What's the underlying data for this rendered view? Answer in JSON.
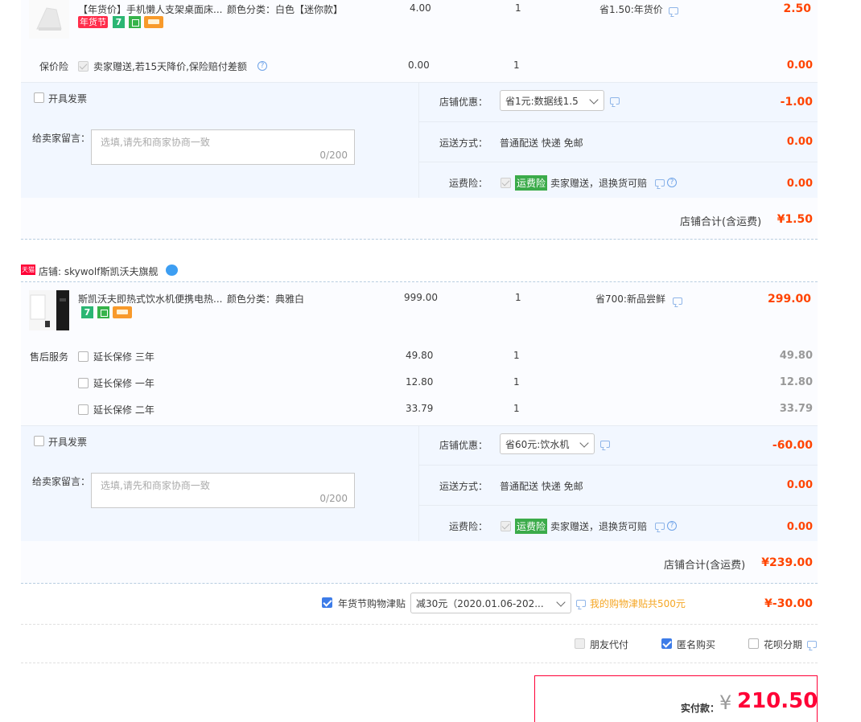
{
  "order1": {
    "product": {
      "title": "【年货价】手机懒人支架桌面床...",
      "attr": "颜色分类：白色【迷你款】",
      "price": "4.00",
      "qty": "1",
      "discount": "省1.50:年货价",
      "subtotal": "2.50",
      "badge": "年货节"
    },
    "insurance": {
      "label": "保价险",
      "text": "卖家赠送,若15天降价,保险赔付差额",
      "price": "0.00",
      "qty": "1",
      "subtotal": "0.00"
    },
    "invoice_label": "开具发票",
    "message_label": "给卖家留言：",
    "message_placeholder": "选填,请先和商家协商一致",
    "message_count": "0/200",
    "coupon_label": "店铺优惠：",
    "coupon_value": "省1元:数据线1.5",
    "coupon_amount": "-1.00",
    "shipping_label": "运送方式：",
    "shipping_value": "普通配送 快递 免邮",
    "shipping_amount": "0.00",
    "freight_label": "运费险：",
    "freight_tag": "运费险",
    "freight_text": "卖家赠送，退换货可赔",
    "freight_amount": "0.00",
    "total_label": "店铺合计(含运费)",
    "total_amount": "¥1.50"
  },
  "order2": {
    "store_badge": "天猫",
    "store_label": "店铺: skywolf斯凯沃夫旗舰",
    "product": {
      "title": "斯凯沃夫即热式饮水机便携电热...",
      "attr": "颜色分类：典雅白",
      "price": "999.00",
      "qty": "1",
      "discount": "省700:新品尝鲜",
      "subtotal": "299.00"
    },
    "service_label": "售后服务",
    "services": [
      {
        "label": "延长保修 三年",
        "price": "49.80",
        "qty": "1",
        "subtotal": "49.80"
      },
      {
        "label": "延长保修 一年",
        "price": "12.80",
        "qty": "1",
        "subtotal": "12.80"
      },
      {
        "label": "延长保修 二年",
        "price": "33.79",
        "qty": "1",
        "subtotal": "33.79"
      }
    ],
    "invoice_label": "开具发票",
    "message_label": "给卖家留言：",
    "message_placeholder": "选填,请先和商家协商一致",
    "message_count": "0/200",
    "coupon_label": "店铺优惠：",
    "coupon_value": "省60元:饮水机",
    "coupon_amount": "-60.00",
    "shipping_label": "运送方式：",
    "shipping_value": "普通配送 快递 免邮",
    "shipping_amount": "0.00",
    "freight_label": "运费险：",
    "freight_tag": "运费险",
    "freight_text": "卖家赠送，退换货可赔",
    "freight_amount": "0.00",
    "total_label": "店铺合计(含运费)",
    "total_amount": "¥239.00"
  },
  "subsidy": {
    "label": "年货节购物津贴",
    "select_value": "减30元（2020.01.06-202...",
    "note": "我的购物津贴共500元",
    "amount": "¥-30.00"
  },
  "options": {
    "friend_pay": "朋友代付",
    "anonymous": "匿名购买",
    "huabei": "花呗分期"
  },
  "payment": {
    "label": "实付款：",
    "currency": "¥",
    "amount": "210.50"
  },
  "colors": {
    "accent_red": "#ff4400",
    "highlight_red": "#e4393c",
    "checkbox_blue": "#3d7ce8",
    "tag_green": "#3bab4a"
  }
}
